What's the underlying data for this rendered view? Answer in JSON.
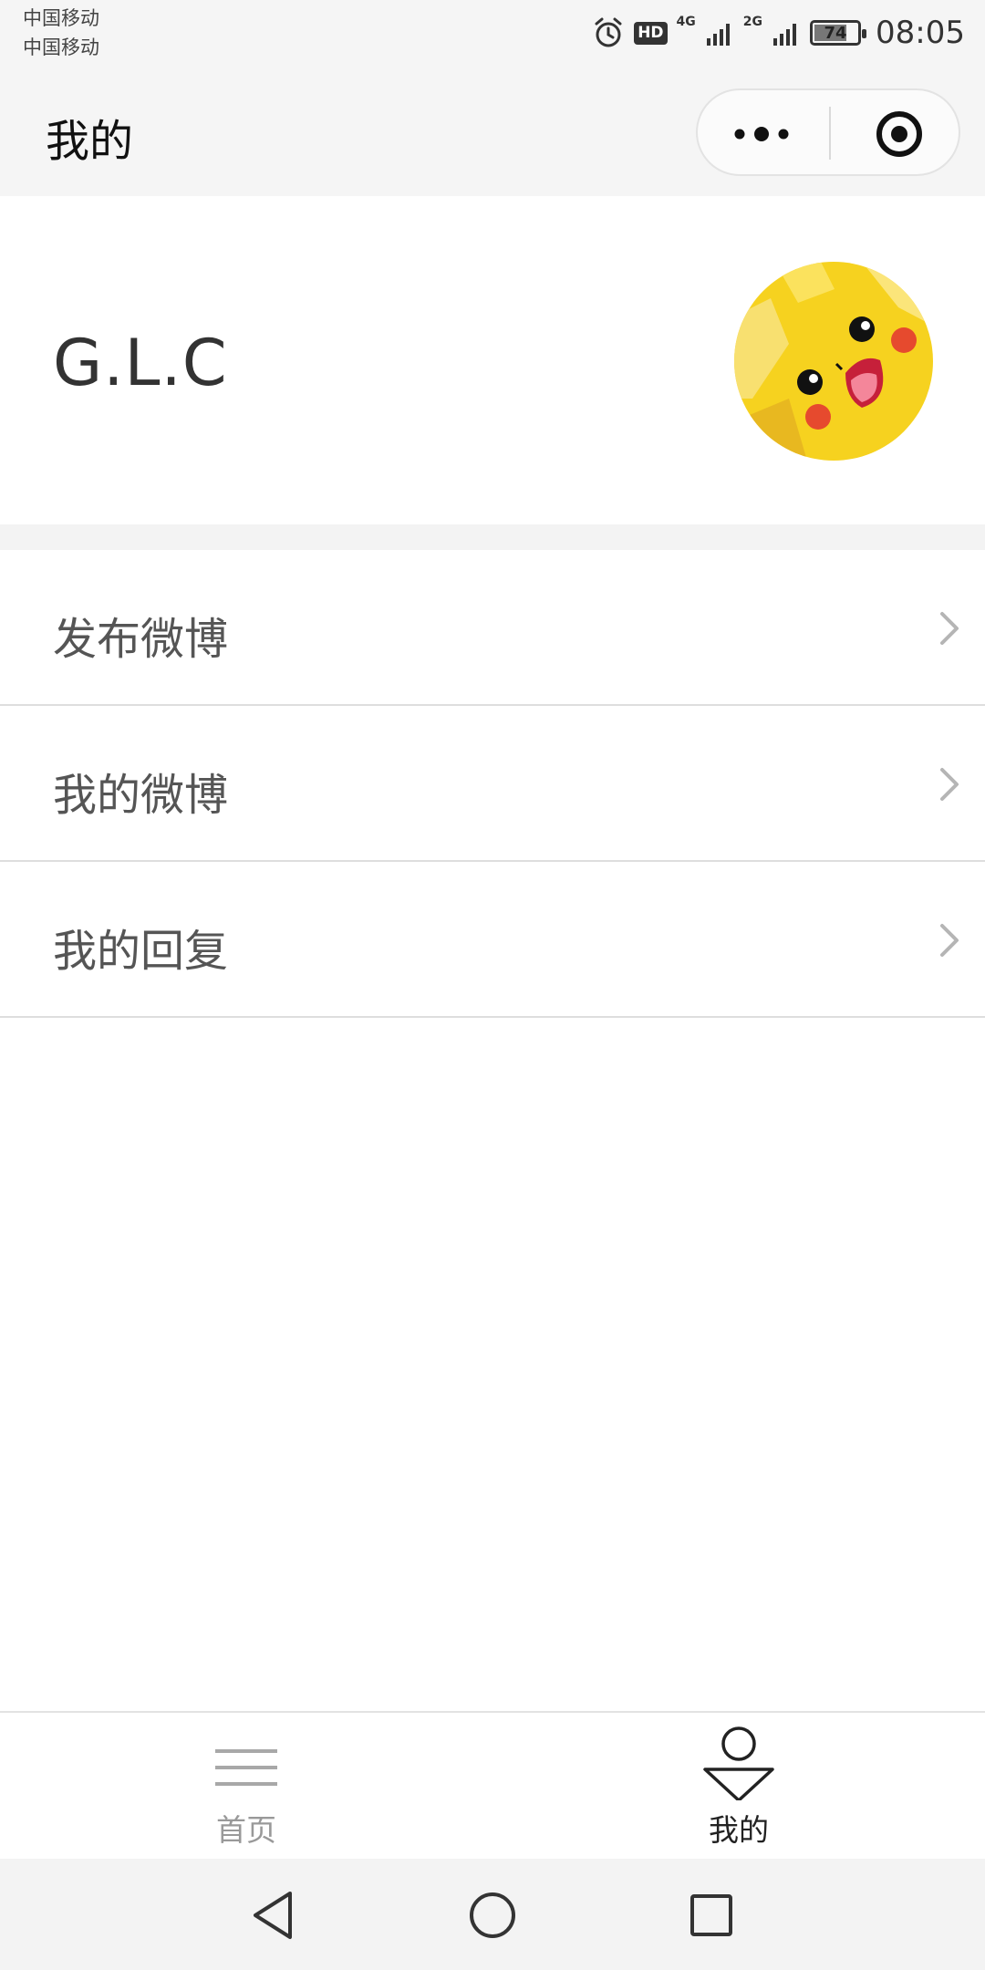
{
  "status_bar": {
    "carrier_1": "中国移动",
    "carrier_2": "中国移动",
    "hd_label": "HD",
    "network_1": "4G",
    "network_2": "2G",
    "battery_level": "74",
    "time": "08:05",
    "icons": [
      "alarm-icon",
      "hd-icon",
      "signal-icon",
      "battery-icon"
    ]
  },
  "nav_bar": {
    "title": "我的",
    "menu_icon": "more-dots-icon",
    "close_icon": "target-circle-icon"
  },
  "profile": {
    "username": "G.L.C",
    "avatar": "pikachu-avatar"
  },
  "menu": {
    "items": [
      {
        "label": "发布微博"
      },
      {
        "label": "我的微博"
      },
      {
        "label": "我的回复"
      }
    ]
  },
  "tab_bar": {
    "tabs": [
      {
        "label": "首页",
        "icon": "hamburger-icon",
        "active": false
      },
      {
        "label": "我的",
        "icon": "user-icon",
        "active": true
      }
    ]
  },
  "colors": {
    "header_bg": "#f5f5f5",
    "text_primary": "#333333",
    "text_secondary": "#555555",
    "tab_inactive": "#999999",
    "avatar_yellow": "#f6d21f"
  }
}
